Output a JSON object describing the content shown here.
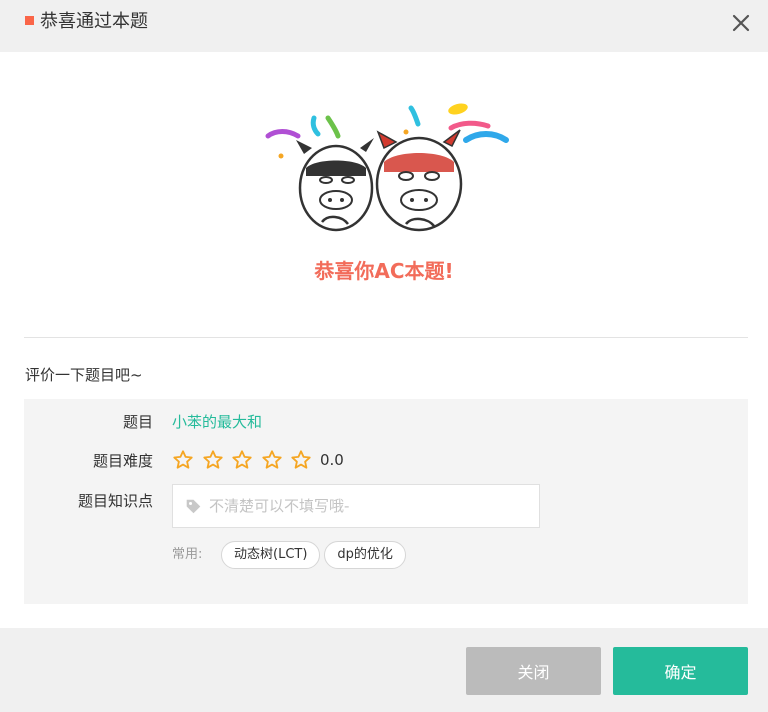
{
  "dialog": {
    "title": "恭喜通过本题",
    "congrats_text": "恭喜你AC本题!"
  },
  "rating": {
    "prompt": "评价一下题目吧~",
    "problem_label": "题目",
    "problem_name": "小苯的最大和",
    "difficulty_label": "题目难度",
    "difficulty_score": "0.0",
    "stars_filled": 0,
    "stars_total": 5,
    "knowledge_label": "题目知识点",
    "knowledge_placeholder": "不清楚可以不填写哦-",
    "common_label": "常用:",
    "common_tags": [
      "动态树(LCT)",
      "dp的优化"
    ]
  },
  "footer": {
    "close_label": "关闭",
    "confirm_label": "确定"
  },
  "colors": {
    "accent": "#25bb9b",
    "title_marker": "#fa6548",
    "congrats": "#f26c5a",
    "star": "#f5a623"
  }
}
